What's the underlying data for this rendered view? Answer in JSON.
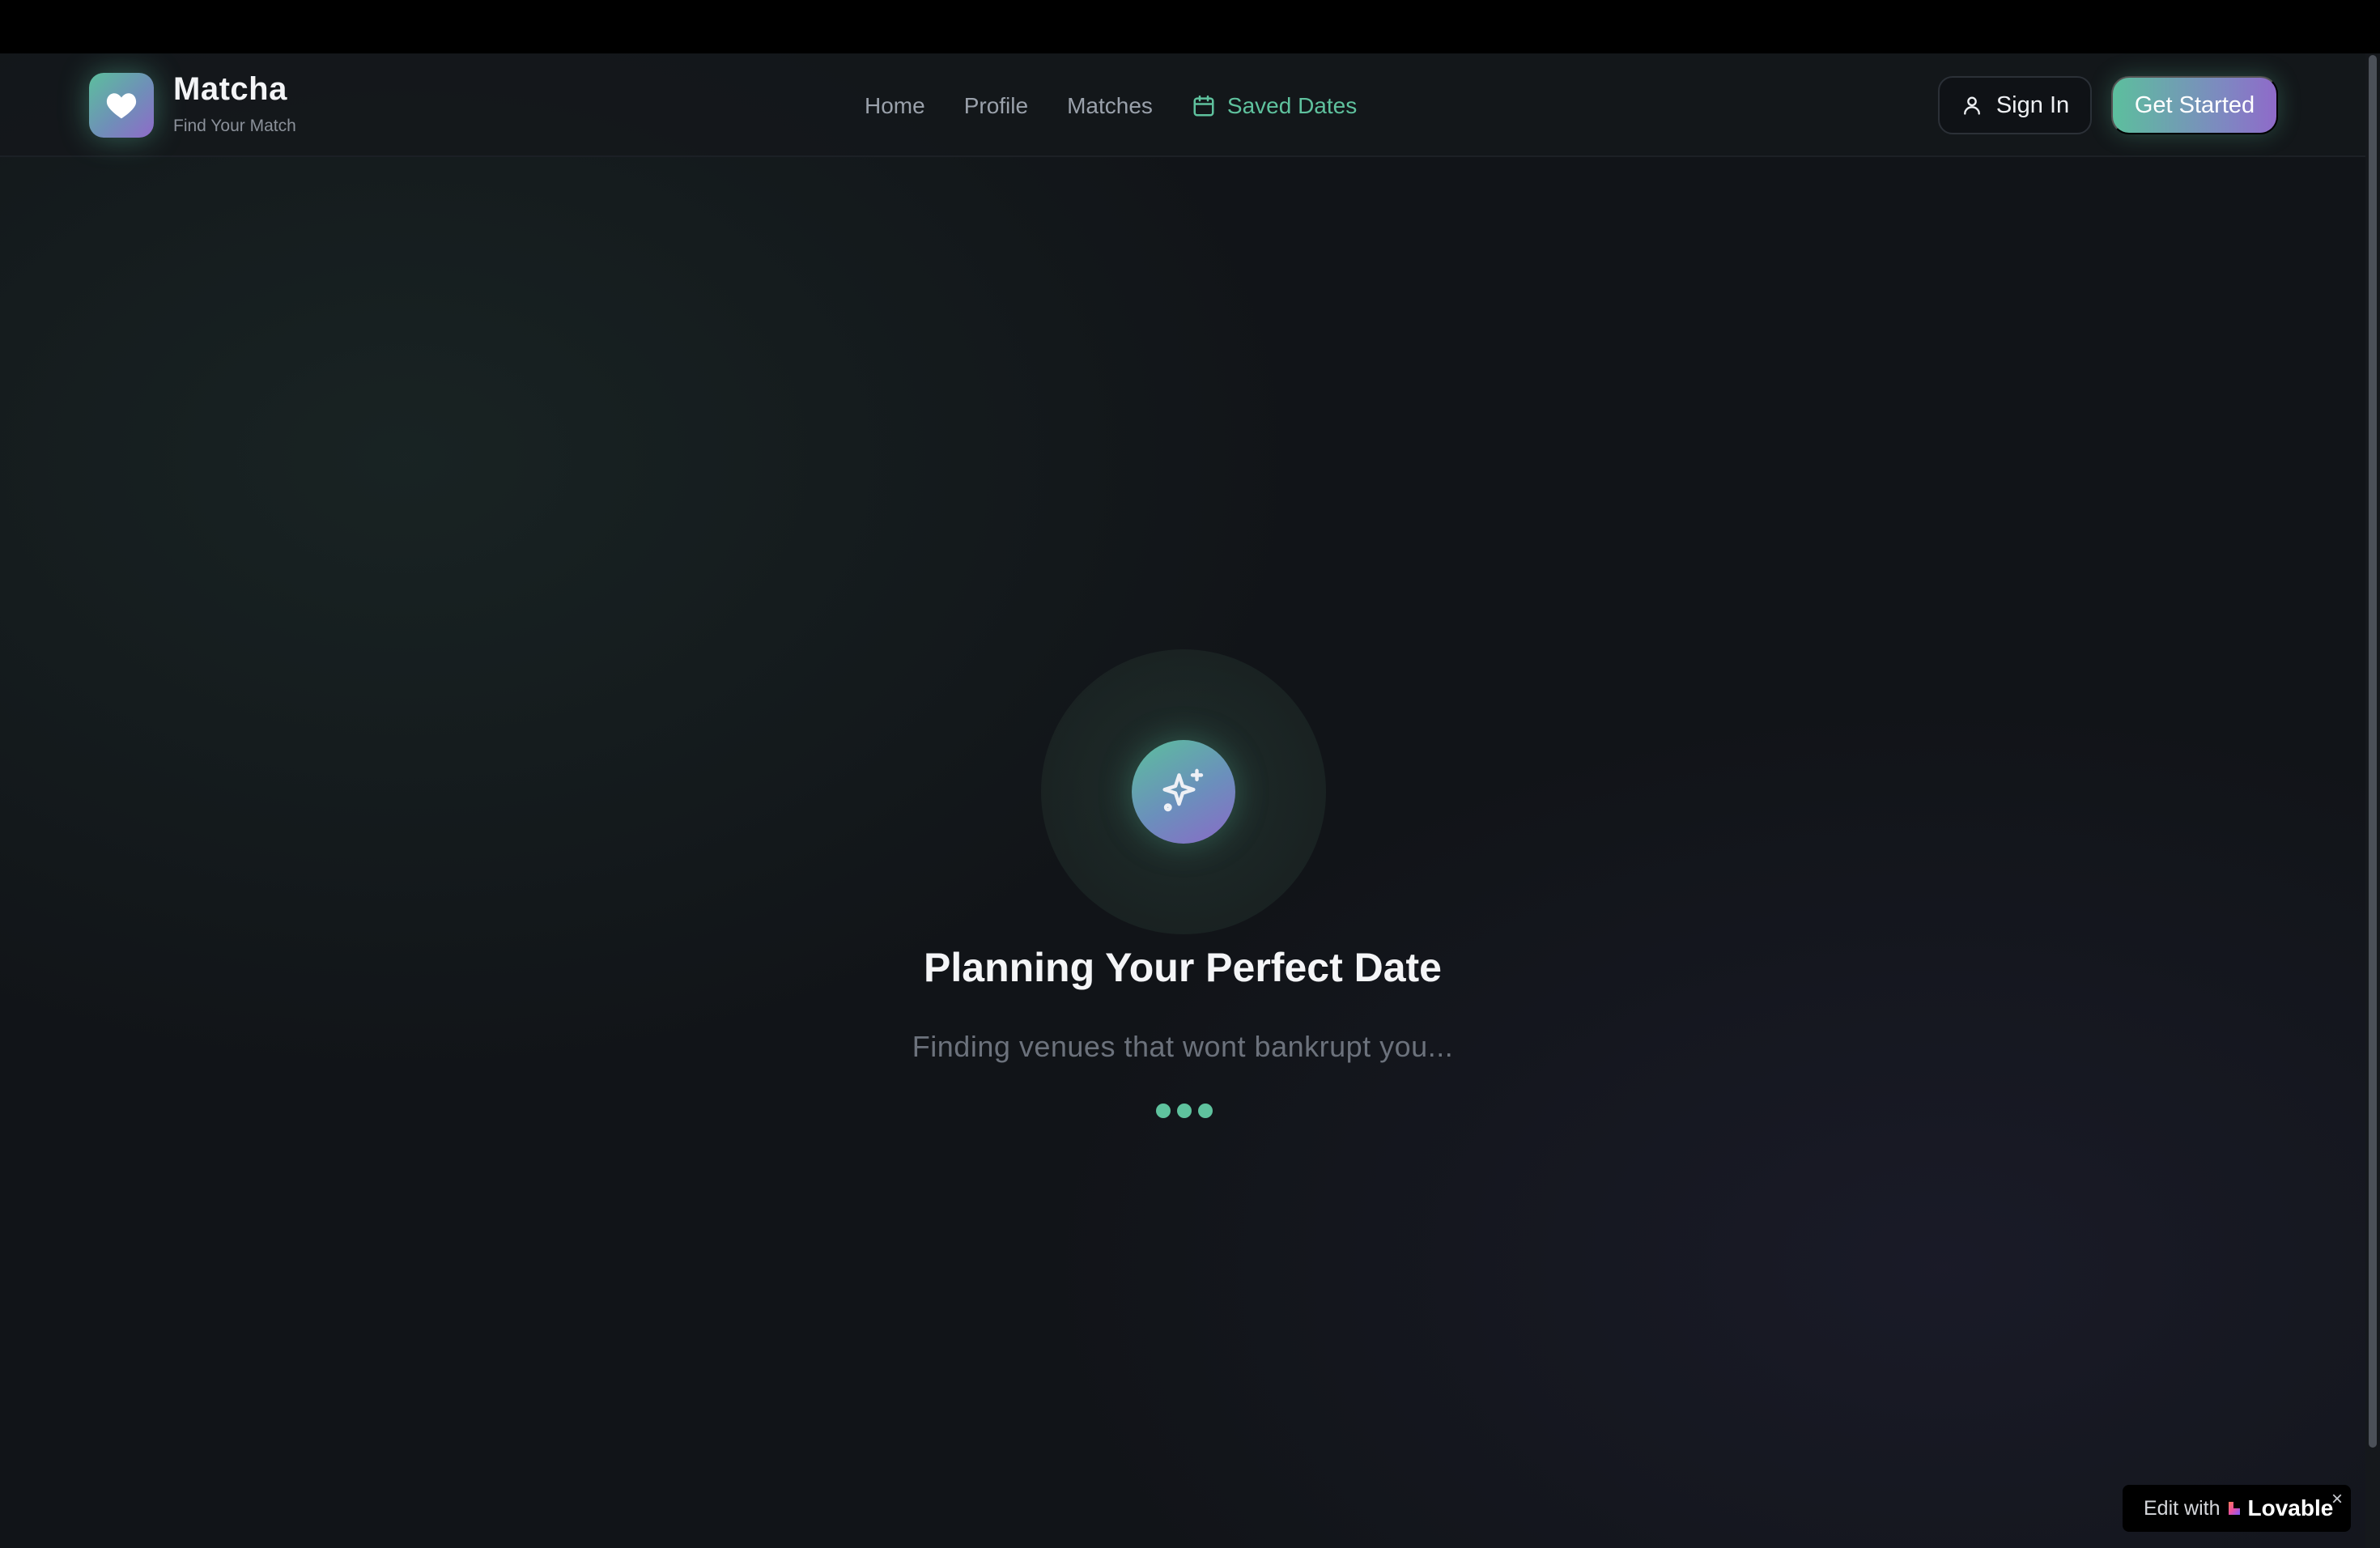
{
  "brand": {
    "name": "Matcha",
    "tagline": "Find Your Match",
    "icon": "heart-icon"
  },
  "nav": {
    "items": [
      {
        "label": "Home"
      },
      {
        "label": "Profile"
      },
      {
        "label": "Matches"
      },
      {
        "label": "Saved Dates",
        "icon": "calendar-icon",
        "active": true
      }
    ]
  },
  "actions": {
    "sign_in": "Sign In",
    "get_started": "Get Started"
  },
  "loading": {
    "icon": "sparkles-icon",
    "title": "Planning Your Perfect Date",
    "subtitle": "Finding venues that wont bankrupt you..."
  },
  "badge": {
    "prefix": "Edit with",
    "name": "Lovable",
    "close": "×"
  },
  "colors": {
    "accent": "#5fc29e",
    "accent_purple": "#8f6ac9",
    "background": "#111418"
  }
}
